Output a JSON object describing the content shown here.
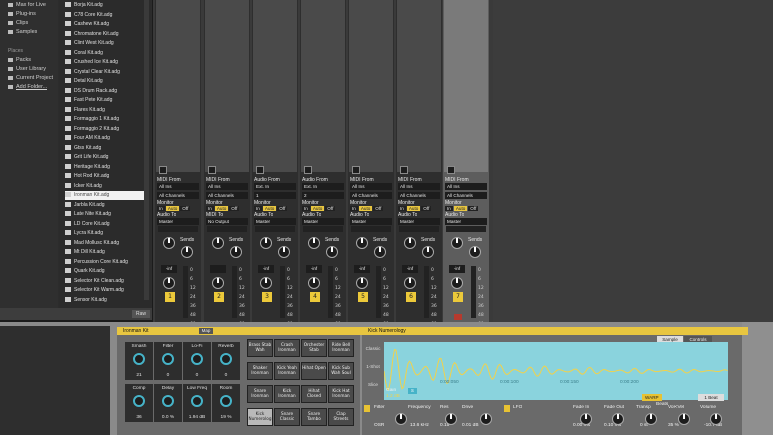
{
  "browser": {
    "places_top": [
      {
        "label": "Max for Live",
        "icon": "folder-icon"
      },
      {
        "label": "Plug-ins",
        "icon": "plug-icon"
      },
      {
        "label": "Clips",
        "icon": "clip-icon"
      },
      {
        "label": "Samples",
        "icon": "sample-icon"
      }
    ],
    "places_header": "Places",
    "places": [
      {
        "label": "Packs"
      },
      {
        "label": "User Library"
      },
      {
        "label": "Current Project"
      },
      {
        "label": "Add Folder..."
      }
    ],
    "files": [
      "Borja Kit.adg",
      "C78 Core Kit.adg",
      "Cashew Kit.adg",
      "Chromatone Kit.adg",
      "Clint West Kit.adg",
      "Coral Kit.adg",
      "Crushed Ice Kit.adg",
      "Crystal Clear Kit.adg",
      "Detal Kit.adg",
      "DS Drum Rack.adg",
      "Fast Pete Kit.adg",
      "Flares Kit.adg",
      "Formaggio 1 Kit.adg",
      "Formaggio 2 Kit.adg",
      "Four AM Kit.adg",
      "Gtss Kit.adg",
      "Grit Life Kit.adg",
      "Heritage Kit.adg",
      "Hot Rod Kit.adg",
      "Icker Kit.adg",
      "Ironman Kit.adg",
      "Jarbla Kit.adg",
      "Late Nite Kit.adg",
      "LD Core Kit.adg",
      "Lycra Kit.adg",
      "Mad Mollusc Kit.adg",
      "Mt Dill Kit.adg",
      "Percussion Core Kit.adg",
      "Quark Kit.adg",
      "Selector Kit Clean.adg",
      "Selector Kit Warm.adg",
      "Sensor Kit.adg"
    ],
    "selected_file_index": 20,
    "preview_label": "Raw"
  },
  "mixer": {
    "tracks": [
      {
        "type": "MIDI From",
        "in": "All Ins",
        "ch": "All Channels",
        "mon": [
          "In",
          "Auto",
          "Off"
        ],
        "mon_on": 1,
        "to_label": "Audio To",
        "to": "Master",
        "num": "1",
        "vol": "-inf",
        "rec": false
      },
      {
        "type": "MIDI From",
        "in": "All Ins",
        "ch": "All Channels",
        "mon": [
          "In",
          "Auto",
          "Off"
        ],
        "mon_on": 1,
        "to_label": "MIDI To",
        "to": "No Output",
        "num": "2",
        "vol": "",
        "rec": false
      },
      {
        "type": "Audio From",
        "in": "Ext. In",
        "ch": "1",
        "mon": [
          "In",
          "Auto",
          "Off"
        ],
        "mon_on": 1,
        "to_label": "Audio To",
        "to": "Master",
        "num": "3",
        "vol": "-inf",
        "rec": false
      },
      {
        "type": "Audio From",
        "in": "Ext. In",
        "ch": "2",
        "mon": [
          "In",
          "Auto",
          "Off"
        ],
        "mon_on": 1,
        "to_label": "Audio To",
        "to": "Master",
        "num": "4",
        "vol": "-inf",
        "rec": false
      },
      {
        "type": "MIDI From",
        "in": "All Ins",
        "ch": "All Channels",
        "mon": [
          "In",
          "Auto",
          "Off"
        ],
        "mon_on": 1,
        "to_label": "Audio To",
        "to": "Master",
        "num": "5",
        "vol": "-inf",
        "rec": false
      },
      {
        "type": "MIDI From",
        "in": "All Ins",
        "ch": "All Channels",
        "mon": [
          "In",
          "Auto",
          "Off"
        ],
        "mon_on": 1,
        "to_label": "Audio To",
        "to": "Master",
        "num": "6",
        "vol": "-inf",
        "rec": false
      },
      {
        "type": "MIDI From",
        "in": "All Ins",
        "ch": "All Channels",
        "mon": [
          "In",
          "Auto",
          "Off"
        ],
        "mon_on": 1,
        "to_label": "Audio To",
        "to": "Master",
        "num": "7",
        "vol": "-inf",
        "rec": true
      }
    ],
    "sends_label": "Sends",
    "scale": [
      "0",
      "6",
      "12",
      "24",
      "36",
      "48",
      "60"
    ]
  },
  "rack": {
    "title": "Ironman Kit",
    "map_label": "Map",
    "macros": [
      {
        "label": "Smash",
        "value": "21"
      },
      {
        "label": "Filter",
        "value": "0"
      },
      {
        "label": "Lo-Fi",
        "value": "0"
      },
      {
        "label": "Reverb",
        "value": "0"
      },
      {
        "label": "Comp",
        "value": "36"
      },
      {
        "label": "Delay",
        "value": "0.0 %"
      },
      {
        "label": "Low Freq",
        "value": "1.94 dB"
      },
      {
        "label": "Room",
        "value": "19 %"
      }
    ],
    "pads": [
      [
        "Brass Stab Wah",
        "Crash Ironman",
        "Orchester Stab",
        "Ride Bell Ironman"
      ],
      [
        "Shaker Ironman",
        "Kick Yeah Ironman",
        "Hihat Open",
        "Kick Sub Wah Soul"
      ],
      [
        "Snare Ironman",
        "Kick Ironman",
        "Hihat Closed",
        "Kick Hat Ironman"
      ],
      [
        "Kick Numerolog",
        "Snare Classic",
        "Snare Tambo",
        "Clap Streets"
      ]
    ],
    "active_pad": "Kick Numerolog"
  },
  "sampler": {
    "title": "Kick Numerology",
    "tabs": [
      "Sample",
      "Controls"
    ],
    "mode_buttons": [
      "Classic",
      "1-Shot",
      "Slice"
    ],
    "gain_label": "Gain",
    "gain": "1.2 dB",
    "warp": "WARP",
    "warp_mode": "Beats",
    "beat": "1 Beat",
    "ruler": [
      "0:00:050",
      "0:00:100",
      "0:00:150",
      "0:00:200"
    ],
    "params": [
      "Filter",
      "Frequency",
      "Res",
      "Drive",
      "LFO",
      "Fade In",
      "Fade Out",
      "Transp",
      "Vol<Vel",
      "Volume"
    ],
    "values": [
      "OSR",
      "13.6 kHz",
      "0.15",
      "0.01 dB",
      "0.00 ms",
      "0.10 ms",
      "0 st",
      "35 %",
      "-10.7 dB"
    ],
    "accent": "#46b3c8"
  }
}
